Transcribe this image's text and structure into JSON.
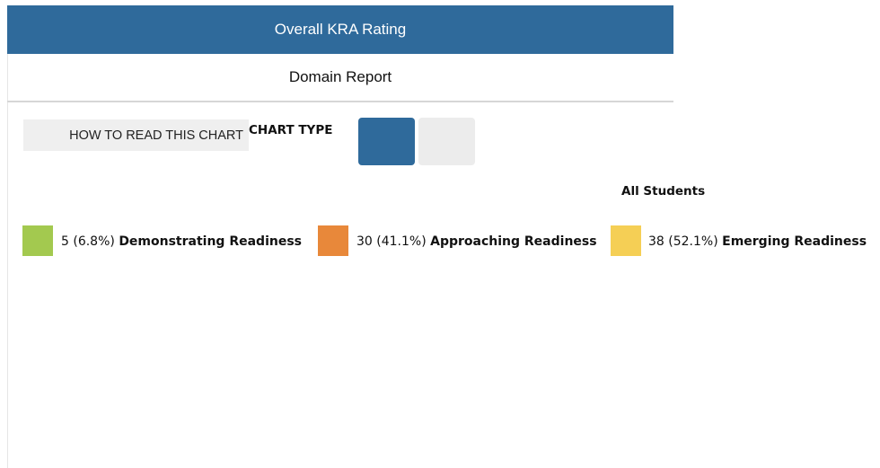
{
  "header": {
    "title": "Overall KRA Rating"
  },
  "subheader": {
    "title": "Domain Report"
  },
  "controls": {
    "how_to_read_label": "HOW TO READ THIS CHART",
    "chart_type_label": "CHART TYPE",
    "chart_type_options": [
      {
        "icon": "chart-type-option-1",
        "selected": true,
        "color": "#2f6a9b"
      },
      {
        "icon": "chart-type-option-2",
        "selected": false,
        "color": "#ececec"
      }
    ]
  },
  "group": {
    "label": "All Students"
  },
  "legend": [
    {
      "count_text": "5 (6.8%)",
      "label": "Demonstrating Readiness",
      "color": "#a3c94f"
    },
    {
      "count_text": "30 (41.1%)",
      "label": "Approaching Readiness",
      "color": "#e8883a"
    },
    {
      "count_text": "38 (52.1%)",
      "label": "Emerging Readiness",
      "color": "#f5cf55"
    }
  ]
}
